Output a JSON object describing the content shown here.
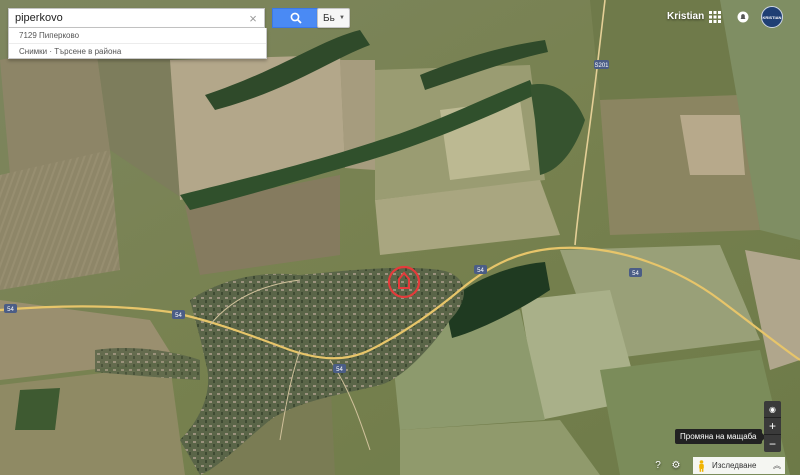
{
  "search": {
    "value": "piperkovo",
    "clear_glyph": "×",
    "suggestions": [
      "7129 Пиперково",
      "Снимки · Търсене в района"
    ]
  },
  "language": {
    "label": "Бь",
    "chevron": "▼"
  },
  "user": {
    "name": "Kristian",
    "avatar_text": "KRISTIAN"
  },
  "road_labels": {
    "s201": "S201",
    "r54_west": "54",
    "r54_center": "54",
    "r54_village": "54",
    "r54_east": "54"
  },
  "controls": {
    "locate_glyph": "◉",
    "zoom_in_glyph": "+",
    "zoom_out_glyph": "−",
    "tooltip": "Промяна на мащаба"
  },
  "bottom": {
    "help_glyph": "?",
    "settings_glyph": "⚙",
    "explore_label": "Изследване",
    "explore_chevron": "︽"
  },
  "icons": {
    "search": "search-icon",
    "apps": "apps-grid-icon",
    "notifications": "notifications-icon",
    "marker": "place-marker-icon",
    "pegman": "pegman-icon"
  },
  "colors": {
    "search_button": "#4a8af4",
    "road": "#e9c56a",
    "marker": "#e43b3b",
    "shield": "#4b5d86"
  }
}
